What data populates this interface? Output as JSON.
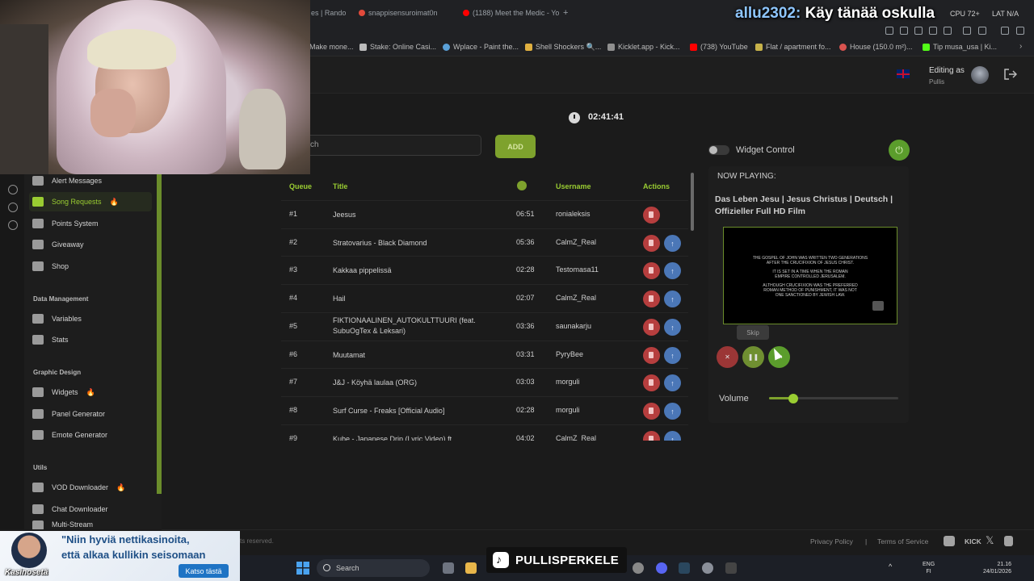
{
  "browser": {
    "tabs": [
      "es | Rando",
      "snappisensuroimat0n",
      "(1188) Meet the Medic - Yo"
    ],
    "bookmarks": [
      "Make mone...",
      "Stake: Online Casi...",
      "Wplace - Paint the...",
      "Shell Shockers 🔍...",
      "Kicklet.app - Kick...",
      "(738) YouTube",
      "Flat / apartment fo...",
      "House (150.0 m²)...",
      "Tip musa_usa | Ki..."
    ]
  },
  "overlay": {
    "username": "allu2302:",
    "message": " Käy tänää oskulla",
    "cpu": "CPU 72+",
    "lan": "LAT N/A"
  },
  "header": {
    "editing_label": "Editing as",
    "editing_user": "Pullis"
  },
  "sidebar": {
    "items_top": [
      {
        "label": "Alert Messages",
        "icon": "warning-icon",
        "fire": false,
        "active": false
      },
      {
        "label": "Song Requests",
        "icon": "music-note-icon",
        "fire": true,
        "active": true
      },
      {
        "label": "Points System",
        "icon": "star-icon",
        "fire": false,
        "active": false
      },
      {
        "label": "Giveaway",
        "icon": "gift-icon",
        "fire": false,
        "active": false
      },
      {
        "label": "Shop",
        "icon": "cart-icon",
        "fire": false,
        "active": false
      }
    ],
    "section_data": "Data Management",
    "items_data": [
      {
        "label": "Variables",
        "icon": "link-icon"
      },
      {
        "label": "Stats",
        "icon": "bar-chart-icon"
      }
    ],
    "section_graphic": "Graphic Design",
    "items_graphic": [
      {
        "label": "Widgets",
        "icon": "video-icon",
        "fire": true
      },
      {
        "label": "Panel Generator",
        "icon": "clipboard-icon",
        "fire": false
      },
      {
        "label": "Emote Generator",
        "icon": "smile-icon",
        "fire": false
      }
    ],
    "section_utils": "Utils",
    "items_utils": [
      {
        "label": "VOD Downloader",
        "icon": "film-icon",
        "fire": true
      },
      {
        "label": "Chat Downloader",
        "icon": "chat-icon",
        "fire": false
      },
      {
        "label": "Multi-Stream",
        "icon": "screen-icon",
        "fire": false
      }
    ],
    "fire_glyph": "🔥"
  },
  "main": {
    "timer": "02:41:41",
    "search_text": "ch",
    "add_label": "ADD",
    "columns": {
      "queue": "Queue",
      "title": "Title",
      "username": "Username",
      "actions": "Actions"
    },
    "songs": [
      {
        "queue": "#1",
        "title": "Jeesus",
        "duration": "06:51",
        "username": "ronialeksis",
        "up": false
      },
      {
        "queue": "#2",
        "title": "Stratovarius - Black Diamond",
        "duration": "05:36",
        "username": "CalmZ_Real",
        "up": true
      },
      {
        "queue": "#3",
        "title": "Kakkaa pippelissä",
        "duration": "02:28",
        "username": "Testomasa11",
        "up": true
      },
      {
        "queue": "#4",
        "title": "Hail",
        "duration": "02:07",
        "username": "CalmZ_Real",
        "up": true
      },
      {
        "queue": "#5",
        "title": "FIKTIONAALINEN_AUTOKULTTUURI (feat. SubuOgTex & Leksari)",
        "duration": "03:36",
        "username": "saunakarju",
        "up": true
      },
      {
        "queue": "#6",
        "title": "Muutamat",
        "duration": "03:31",
        "username": "PyryBee",
        "up": true
      },
      {
        "queue": "#7",
        "title": "J&J - Köyhä laulaa (ORG)",
        "duration": "03:03",
        "username": "morguli",
        "up": true
      },
      {
        "queue": "#8",
        "title": "Surf Curse - Freaks [Official Audio]",
        "duration": "02:28",
        "username": "morguli",
        "up": true
      },
      {
        "queue": "#9",
        "title": "Kube - Japanese Drip (Lyric Video) ft.",
        "duration": "04:02",
        "username": "CalmZ_Real",
        "up": true
      }
    ],
    "up_glyph": "↑"
  },
  "widget": {
    "control_label": "Widget Control",
    "now_playing_label": "NOW PLAYING:",
    "now_playing_title": "Das Leben Jesu | Jesus Christus | Deutsch | Offizieller Full HD Film",
    "video_lines": [
      "THE GOSPEL OF JOHN WAS WRITTEN TWO GENERATIONS",
      "AFTER THE CRUCIFIXION OF JESUS CHRIST.",
      "IT IS SET IN A TIME WHEN THE ROMAN",
      "EMPIRE CONTROLLED JERUSALEM.",
      "ALTHOUGH CRUCIFIXION WAS THE PREFERRED",
      "ROMAN METHOD OF PUNISHMENT, IT WAS NOT",
      "ONE SANCTIONED BY JEWISH LAW."
    ],
    "skip_tooltip": "Skip",
    "volume_label": "Volume",
    "volume_fraction": 0.19,
    "power_glyph": "⏻",
    "stop_glyph": "✕",
    "pause_glyph": "❚❚",
    "skip_glyph": "⏭"
  },
  "footer": {
    "copyright": "ts reserved.",
    "privacy": "Privacy Policy",
    "separator": "|",
    "terms": "Terms of Service",
    "kick": "KICK"
  },
  "taskbar": {
    "search": "Search",
    "lang_top": "ENG",
    "lang_bottom": "FI",
    "time": "21.16",
    "date": "24/01/2026"
  },
  "tiktok": {
    "handle": "PULLISPERKELE"
  },
  "ad": {
    "line1": "\"Niin hyviä nettikasinoita,",
    "line2": "että alkaa kullikin seisomaan",
    "brand": "Kasinosetä",
    "button": "Katso tästä"
  },
  "colors": {
    "accent": "#9acd32",
    "delete": "#b63e3e",
    "upvote": "#4b77b7",
    "power": "#5b9d2c"
  }
}
